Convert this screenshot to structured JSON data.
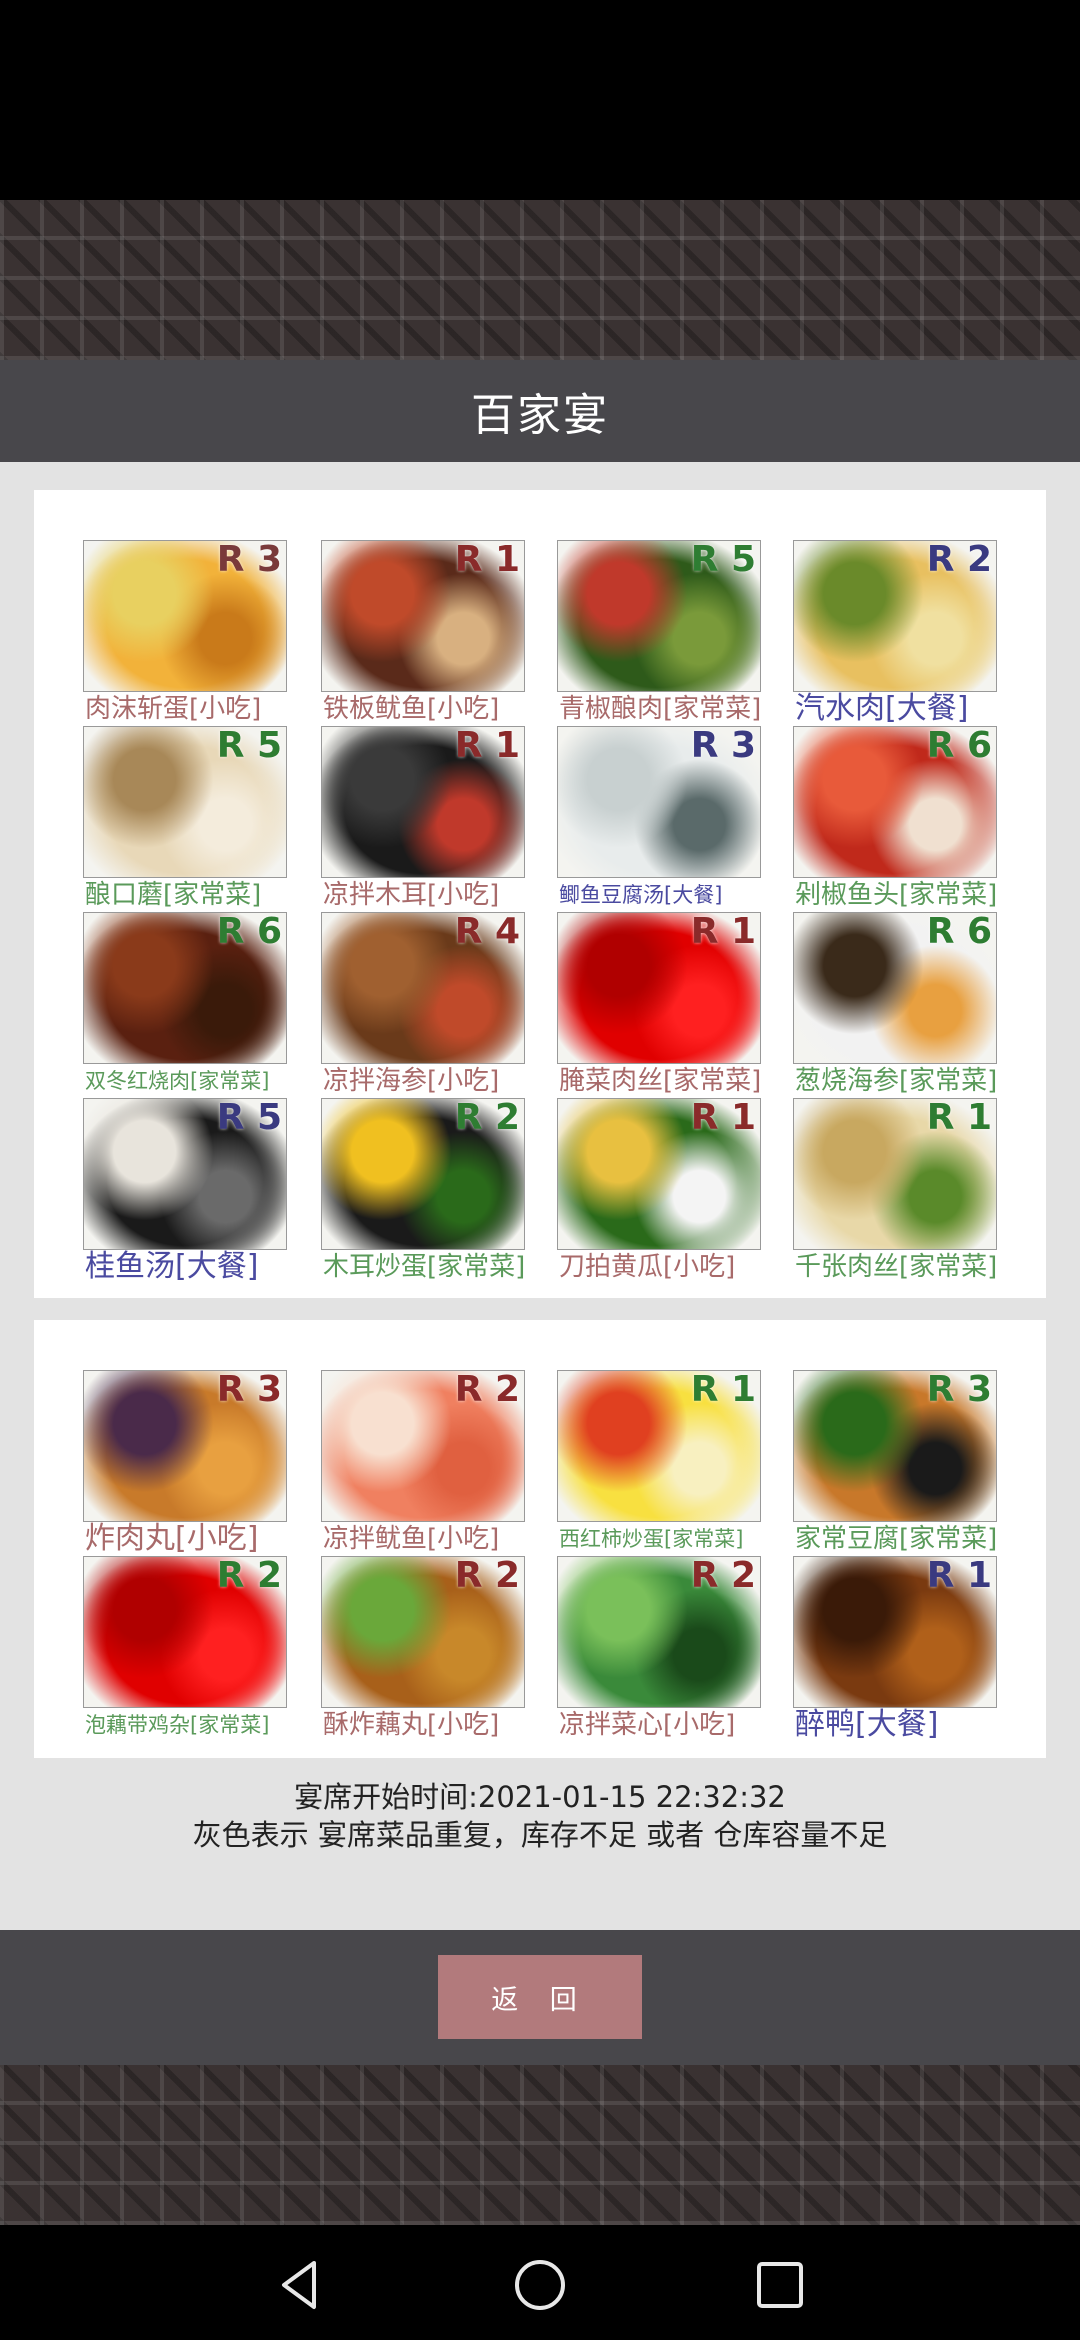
{
  "title": "百家宴",
  "panel1": [
    {
      "name": "肉沫斩蛋[小吃]",
      "tag": "R 3",
      "tag_color": "#7a3a3a",
      "label_color": "#a86a6a",
      "label_size": "normal",
      "colors": [
        "#f2b23a",
        "#e8d060",
        "#c97a1a"
      ]
    },
    {
      "name": "铁板鱿鱼[小吃]",
      "tag": "R 1",
      "tag_color": "#8a2a2a",
      "label_color": "#a86a6a",
      "label_size": "normal",
      "colors": [
        "#5a2a1a",
        "#c04a2a",
        "#d8b080"
      ]
    },
    {
      "name": "青椒酿肉[家常菜]",
      "tag": "R 5",
      "tag_color": "#2e7d32",
      "label_color": "#a86a6a",
      "label_size": "normal",
      "colors": [
        "#2e5a1a",
        "#c0392b",
        "#7a9a3a"
      ]
    },
    {
      "name": "汽水肉[大餐]",
      "tag": "R 2",
      "tag_color": "#3a3a80",
      "label_color": "#4a4aa0",
      "label_size": "big",
      "colors": [
        "#e8c060",
        "#6a8a2a",
        "#f0e0a0"
      ]
    },
    {
      "name": "酿口蘑[家常菜]",
      "tag": "R 5",
      "tag_color": "#2e7d32",
      "label_color": "#5a9a5a",
      "label_size": "normal",
      "colors": [
        "#e8d8b8",
        "#a88858",
        "#f4ecdc"
      ]
    },
    {
      "name": "凉拌木耳[小吃]",
      "tag": "R 1",
      "tag_color": "#8a2a2a",
      "label_color": "#a86a6a",
      "label_size": "normal",
      "colors": [
        "#1a1a1a",
        "#3a3a3a",
        "#c0392b"
      ]
    },
    {
      "name": "鲫鱼豆腐汤[大餐]",
      "tag": "R 3",
      "tag_color": "#3a3a80",
      "label_color": "#4a4aa0",
      "label_size": "small",
      "colors": [
        "#e8ecec",
        "#c8d0d0",
        "#5a6a6a"
      ]
    },
    {
      "name": "剁椒鱼头[家常菜]",
      "tag": "R 6",
      "tag_color": "#2e7d32",
      "label_color": "#5a9a5a",
      "label_size": "normal",
      "colors": [
        "#c0291b",
        "#e85a3a",
        "#f0e0d0"
      ]
    },
    {
      "name": "双冬红烧肉[家常菜]",
      "tag": "R 6",
      "tag_color": "#2e7d32",
      "label_color": "#5a9a5a",
      "label_size": "small",
      "colors": [
        "#5a2010",
        "#8a3a1a",
        "#3a1a0a"
      ]
    },
    {
      "name": "凉拌海参[小吃]",
      "tag": "R 4",
      "tag_color": "#8a2a2a",
      "label_color": "#a86a6a",
      "label_size": "normal",
      "colors": [
        "#6a3a1a",
        "#a06030",
        "#c04a2a"
      ]
    },
    {
      "name": "腌菜肉丝[家常菜]",
      "tag": "R 1",
      "tag_color": "#8a2a2a",
      "label_color": "#a86a6a",
      "label_size": "normal",
      "colors": [
        "#e00000",
        "#b00000",
        "#ff2020"
      ]
    },
    {
      "name": "葱烧海参[家常菜]",
      "tag": "R 6",
      "tag_color": "#2e7d32",
      "label_color": "#5a9a5a",
      "label_size": "normal",
      "colors": [
        "#f2f2f2",
        "#3a2a1a",
        "#e8a040"
      ]
    },
    {
      "name": "桂鱼汤[大餐]",
      "tag": "R 5",
      "tag_color": "#3a3a80",
      "label_color": "#4a4aa0",
      "label_size": "big",
      "colors": [
        "#1a1a1a",
        "#e8e4dc",
        "#6a6a6a"
      ]
    },
    {
      "name": "木耳炒蛋[家常菜]",
      "tag": "R 2",
      "tag_color": "#2e7d32",
      "label_color": "#5a9a5a",
      "label_size": "normal",
      "colors": [
        "#1a1a1a",
        "#f0c020",
        "#2a6a1a"
      ]
    },
    {
      "name": "刀拍黄瓜[小吃]",
      "tag": "R 1",
      "tag_color": "#8a2a2a",
      "label_color": "#a86a6a",
      "label_size": "normal",
      "colors": [
        "#2a6a1a",
        "#e8c040",
        "#f4f4f4"
      ]
    },
    {
      "name": "千张肉丝[家常菜]",
      "tag": "R 1",
      "tag_color": "#2e7d32",
      "label_color": "#5a9a5a",
      "label_size": "normal",
      "colors": [
        "#e8d8a8",
        "#c8a860",
        "#5a8a2a"
      ]
    }
  ],
  "panel2": [
    {
      "name": "炸肉丸[小吃]",
      "tag": "R 3",
      "tag_color": "#8a2a2a",
      "label_color": "#a86a6a",
      "label_size": "big",
      "colors": [
        "#c87a2a",
        "#4a2a4a",
        "#e8a040"
      ]
    },
    {
      "name": "凉拌鱿鱼[小吃]",
      "tag": "R 2",
      "tag_color": "#8a2a2a",
      "label_color": "#a86a6a",
      "label_size": "normal",
      "colors": [
        "#f08060",
        "#f8e0d0",
        "#e06040"
      ]
    },
    {
      "name": "西红柿炒蛋[家常菜]",
      "tag": "R 1",
      "tag_color": "#2e7d32",
      "label_color": "#5a9a5a",
      "label_size": "small",
      "colors": [
        "#f8e040",
        "#e04020",
        "#f8f0c0"
      ]
    },
    {
      "name": "家常豆腐[家常菜]",
      "tag": "R 3",
      "tag_color": "#2e7d32",
      "label_color": "#5a9a5a",
      "label_size": "normal",
      "colors": [
        "#c8782a",
        "#2a6a1a",
        "#1a1a1a"
      ]
    },
    {
      "name": "泡藕带鸡杂[家常菜]",
      "tag": "R 2",
      "tag_color": "#2e7d32",
      "label_color": "#5a9a5a",
      "label_size": "small",
      "colors": [
        "#e00000",
        "#b00000",
        "#ff2020"
      ]
    },
    {
      "name": "酥炸藕丸[小吃]",
      "tag": "R 2",
      "tag_color": "#8a2a2a",
      "label_color": "#a86a6a",
      "label_size": "normal",
      "colors": [
        "#a8601a",
        "#6aa83a",
        "#c8882a"
      ]
    },
    {
      "name": "凉拌菜心[小吃]",
      "tag": "R 2",
      "tag_color": "#8a2a2a",
      "label_color": "#a86a6a",
      "label_size": "normal",
      "colors": [
        "#3a8a3a",
        "#7ac05a",
        "#1a4a1a"
      ]
    },
    {
      "name": "醉鸭[大餐]",
      "tag": "R 1",
      "tag_color": "#3a3a80",
      "label_color": "#4a4aa0",
      "label_size": "big",
      "colors": [
        "#7a3a10",
        "#3a1a08",
        "#b0601a"
      ]
    }
  ],
  "info": {
    "start_time": "宴席开始时间:2021-01-15 22:32:32",
    "note": "灰色表示 宴席菜品重复，库存不足 或者 仓库容量不足"
  },
  "back_label": "返 回",
  "nav": {
    "back_icon": "back-triangle-icon",
    "home_icon": "home-circle-icon",
    "recents_icon": "recents-square-icon"
  }
}
